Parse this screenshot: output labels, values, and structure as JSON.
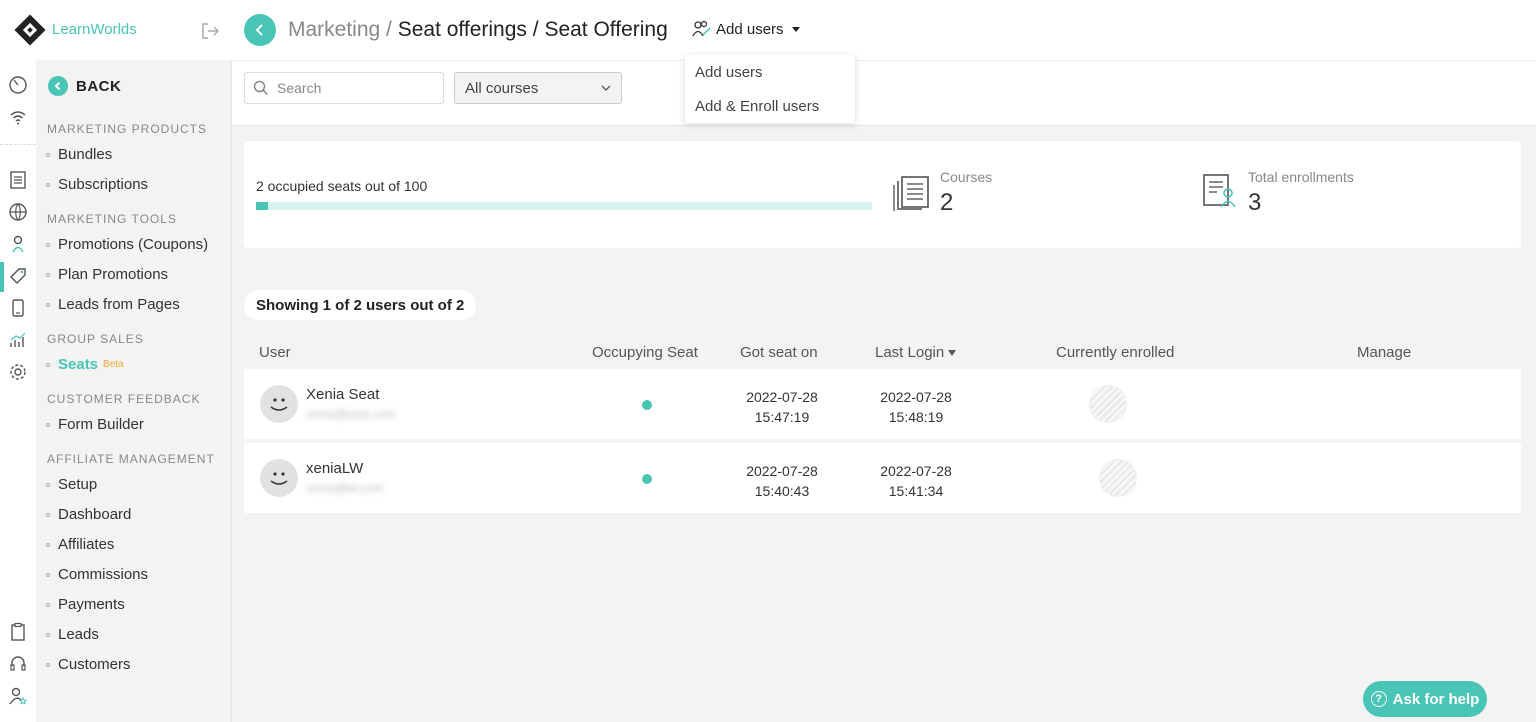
{
  "brand": {
    "name": "LearnWorlds"
  },
  "sidebar": {
    "back_label": "BACK",
    "sections": [
      {
        "title": "MARKETING PRODUCTS",
        "items": [
          "Bundles",
          "Subscriptions"
        ]
      },
      {
        "title": "MARKETING TOOLS",
        "items": [
          "Promotions (Coupons)",
          "Plan Promotions",
          "Leads from Pages"
        ]
      },
      {
        "title": "GROUP SALES",
        "items": [
          "Seats"
        ]
      },
      {
        "title": "CUSTOMER FEEDBACK",
        "items": [
          "Form Builder"
        ]
      },
      {
        "title": "AFFILIATE MANAGEMENT",
        "items": [
          "Setup",
          "Dashboard",
          "Affiliates",
          "Commissions",
          "Payments",
          "Leads",
          "Customers"
        ]
      }
    ],
    "active_item": "Seats",
    "beta_badge": "Beta"
  },
  "header": {
    "crumb_root": "Marketing",
    "crumb_sep": " / ",
    "crumb_mid": "Seat offerings",
    "crumb_current": "Seat Offering",
    "add_users_label": "Add users"
  },
  "dropdown": {
    "options": [
      "Add users",
      "Add & Enroll users"
    ]
  },
  "filters": {
    "search_placeholder": "Search",
    "course_select": "All courses"
  },
  "stats": {
    "seats_text": "2 occupied seats out of 100",
    "seats_used": 2,
    "seats_total": 100,
    "courses_label": "Courses",
    "courses_value": "2",
    "enrollments_label": "Total enrollments",
    "enrollments_value": "3"
  },
  "showing": "Showing 1 of 2 users out of 2",
  "table": {
    "columns": [
      "User",
      "Occupying Seat",
      "Got seat on",
      "Last Login",
      "Currently enrolled",
      "Manage"
    ],
    "rows": [
      {
        "name": "Xenia Seat",
        "email": "xenia@seat.com",
        "seat_date": "2022-07-28",
        "seat_time": "15:47:19",
        "login_date": "2022-07-28",
        "login_time": "15:48:19"
      },
      {
        "name": "xeniaLW",
        "email": "xenia@lw.com",
        "seat_date": "2022-07-28",
        "seat_time": "15:40:43",
        "login_date": "2022-07-28",
        "login_time": "15:41:34"
      }
    ]
  },
  "help": {
    "label": "Ask for help"
  },
  "colors": {
    "accent": "#49c5b6",
    "beta": "#f2a93b"
  }
}
